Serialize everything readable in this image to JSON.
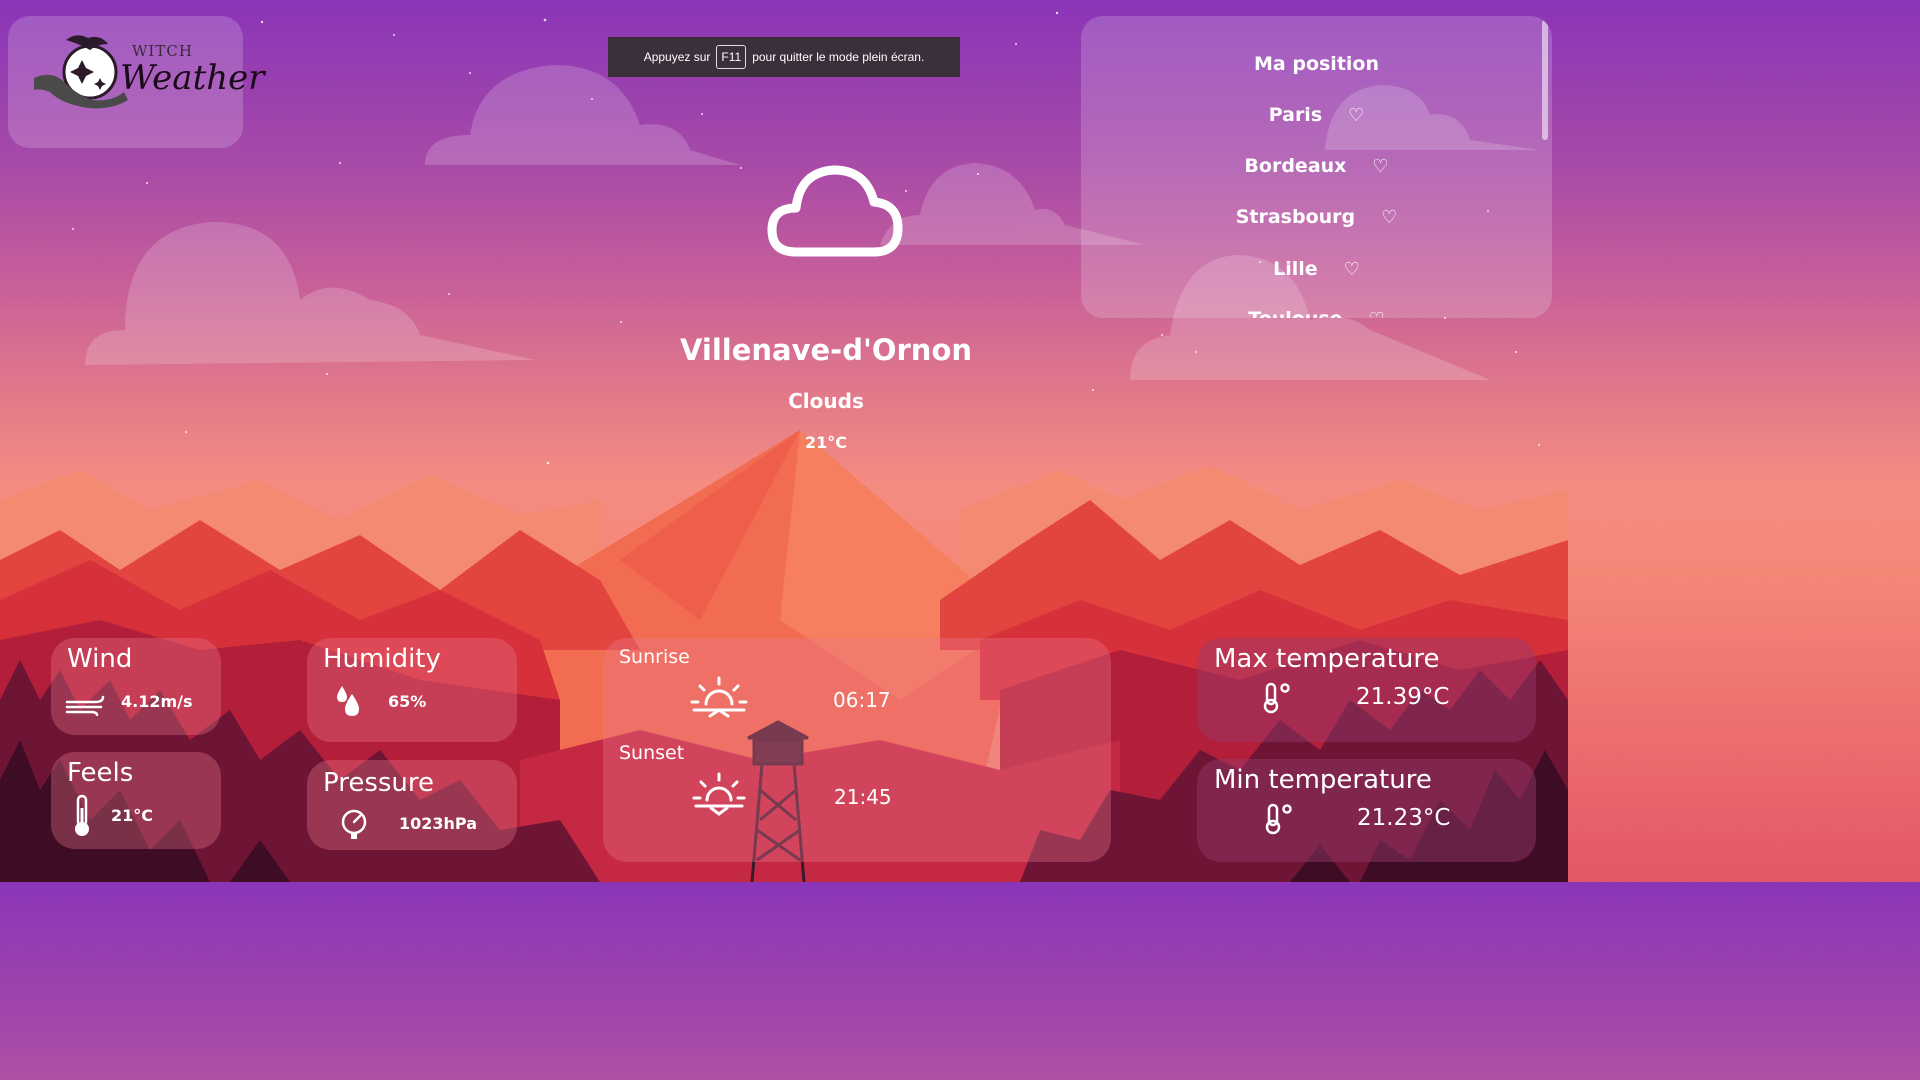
{
  "logo": {
    "line1": "WITCH",
    "line2": "Weather"
  },
  "fullscreen_banner": {
    "before": "Appuyez sur",
    "key": "F11",
    "after": "pour quitter le mode plein écran."
  },
  "cities": {
    "my_position": "Ma position",
    "items": [
      "Paris",
      "Bordeaux",
      "Strasbourg",
      "Lille",
      "Toulouse"
    ]
  },
  "current": {
    "city": "Villenave-d'Ornon",
    "condition": "Clouds",
    "temp": "21°C",
    "icon": "cloud-icon"
  },
  "cards": {
    "wind": {
      "title": "Wind",
      "value": "4.12m/s"
    },
    "feels": {
      "title": "Feels",
      "value": "21°C"
    },
    "humidity": {
      "title": "Humidity",
      "value": "65%"
    },
    "pressure": {
      "title": "Pressure",
      "value": "1023hPa"
    },
    "sunrise": {
      "title": "Sunrise",
      "value": "06:17"
    },
    "sunset": {
      "title": "Sunset",
      "value": "21:45"
    },
    "max_temp": {
      "title": "Max temperature",
      "value": "21.39°C"
    },
    "min_temp": {
      "title": "Min temperature",
      "value": "21.23°C"
    }
  },
  "colors": {
    "sky_top": "#8a35b8",
    "sky_mid": "#e27a8a",
    "mountain": "#f06a50",
    "forest_dark": "#5a1230"
  }
}
